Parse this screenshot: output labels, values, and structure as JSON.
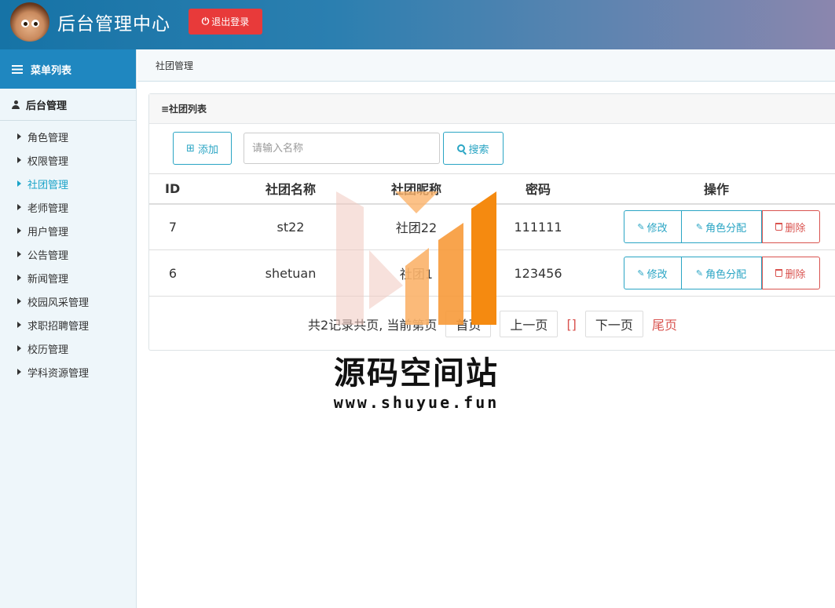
{
  "header": {
    "title": "后台管理中心",
    "logout_label": "退出登录",
    "logout_icon": "power-icon",
    "brand_color": "#1673a6"
  },
  "sidebar": {
    "menu_title": "菜单列表",
    "group_title": "后台管理",
    "items": [
      {
        "label": "角色管理",
        "active": false
      },
      {
        "label": "权限管理",
        "active": false
      },
      {
        "label": "社团管理",
        "active": true
      },
      {
        "label": "老师管理",
        "active": false
      },
      {
        "label": "用户管理",
        "active": false
      },
      {
        "label": "公告管理",
        "active": false
      },
      {
        "label": "新闻管理",
        "active": false
      },
      {
        "label": "校园风采管理",
        "active": false
      },
      {
        "label": "求职招聘管理",
        "active": false
      },
      {
        "label": "校历管理",
        "active": false
      },
      {
        "label": "学科资源管理",
        "active": false
      }
    ]
  },
  "breadcrumb": "社团管理",
  "panel": {
    "title": "≡社团列表",
    "add_label": "添加",
    "search_placeholder": "请输入名称",
    "search_value": "",
    "search_label": "搜索"
  },
  "table": {
    "headers": [
      "ID",
      "社团名称",
      "社团昵称",
      "密码",
      "操作"
    ],
    "rows": [
      {
        "id": "7",
        "name": "st22",
        "nickname": "社团22",
        "password": "111111"
      },
      {
        "id": "6",
        "name": "shetuan",
        "nickname": "社团1",
        "password": "123456"
      }
    ],
    "actions": {
      "edit": "修改",
      "assign": "角色分配",
      "delete": "删除"
    }
  },
  "pager": {
    "summary": "共2记录共页, 当前第页",
    "first": "首页",
    "prev": "上一页",
    "current": "[]",
    "next": "下一页",
    "last": "尾页"
  },
  "watermark": {
    "title": "源码空间站",
    "url": "www.shuyue.fun"
  }
}
